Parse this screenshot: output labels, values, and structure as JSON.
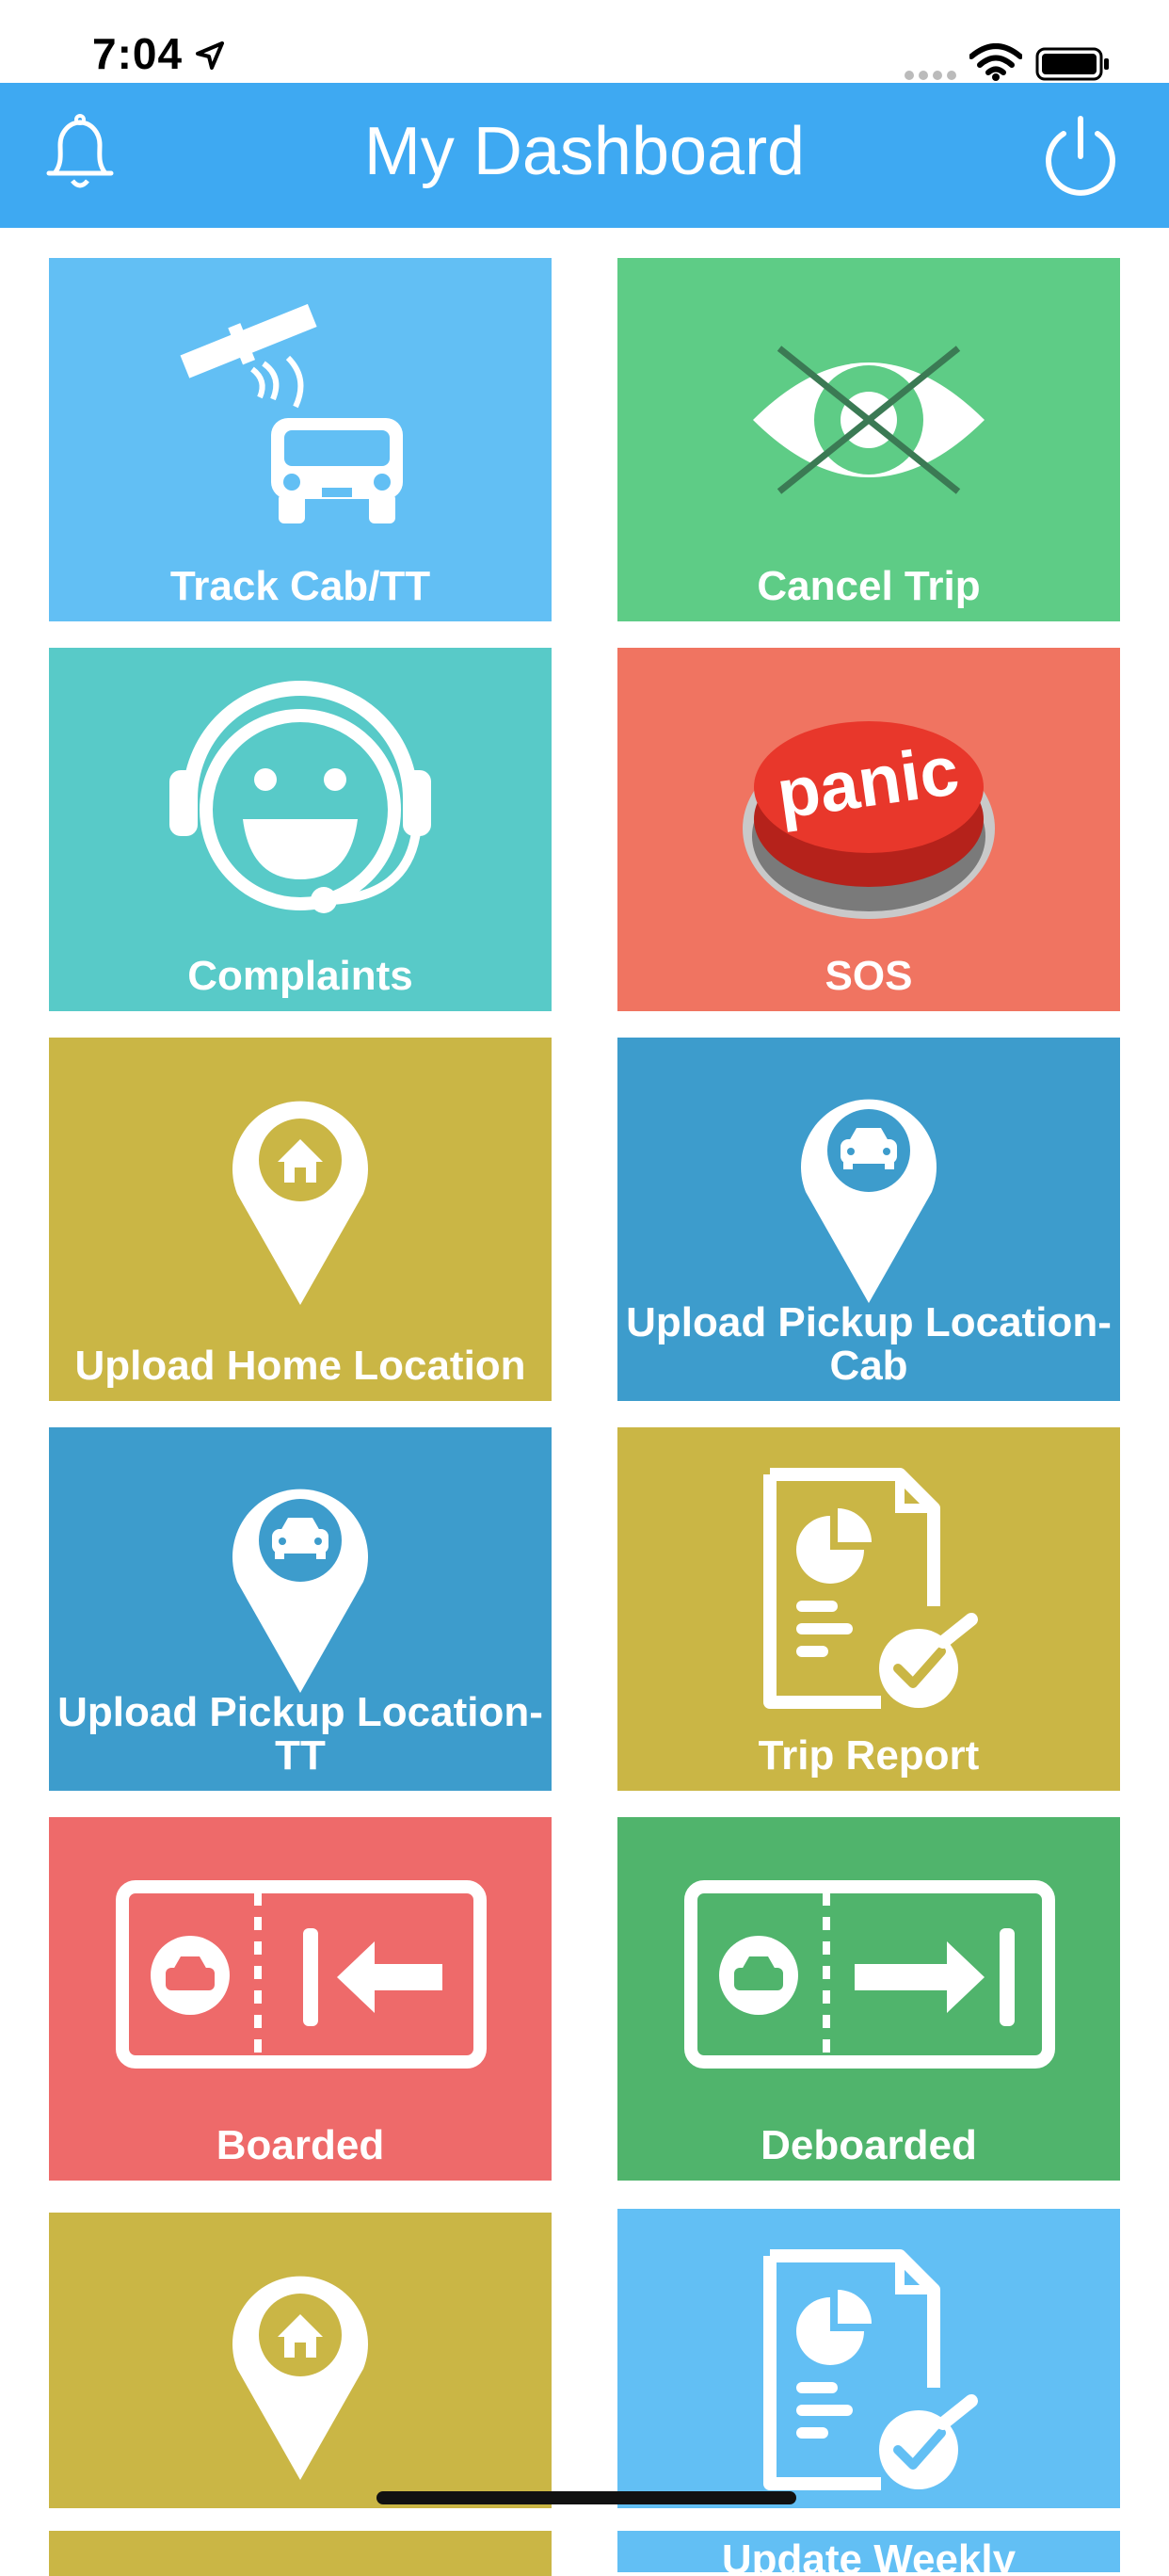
{
  "status_bar": {
    "time": "7:04"
  },
  "header": {
    "title": "My Dashboard"
  },
  "colors": {
    "header": "#3ea9f2",
    "light_blue": "#62bff4",
    "green": "#5ecc86",
    "teal": "#58cac8",
    "salmon": "#f07461",
    "mustard": "#cab645",
    "steel_blue": "#3d9ccc",
    "red": "#ee6a6a",
    "dark_green": "#50b46c"
  },
  "tiles": [
    {
      "label": "Track Cab/TT",
      "icon": "satellite-car-icon"
    },
    {
      "label": "Cancel Trip",
      "icon": "eye-crossed-icon"
    },
    {
      "label": "Complaints",
      "icon": "support-headset-icon"
    },
    {
      "label": "SOS",
      "icon": "panic-button-icon",
      "icon_text": "panic"
    },
    {
      "label": "Upload Home Location",
      "icon": "home-pin-icon"
    },
    {
      "label": "Upload Pickup Location-\nCab",
      "icon": "car-pin-icon"
    },
    {
      "label": "Upload Pickup Location-\nTT",
      "icon": "car-pin-icon"
    },
    {
      "label": "Trip Report",
      "icon": "report-check-icon"
    },
    {
      "label": "Boarded",
      "icon": "ticket-board-icon"
    },
    {
      "label": "Deboarded",
      "icon": "ticket-deboard-icon"
    },
    {
      "label": "",
      "icon": "home-pin-icon"
    },
    {
      "label": "Update Weekly",
      "icon": "report-check-icon"
    }
  ]
}
